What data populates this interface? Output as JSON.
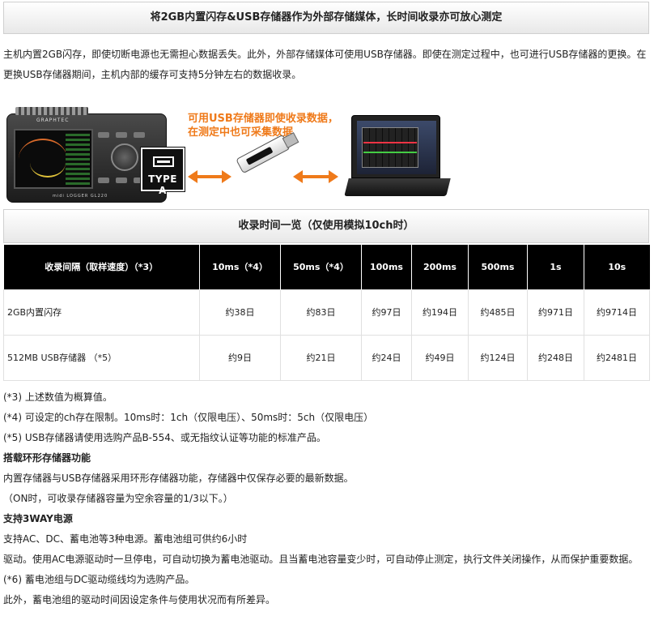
{
  "header": {
    "title": "将2GB内置闪存&USB存储器作为外部存储媒体，长时间收录亦可放心测定"
  },
  "intro": "主机内置2GB闪存，即使切断电源也无需担心数据丢失。此外，外部存储媒体可使用USB存储器。即使在测定过程中，也可进行USB存储器的更换。在更换USB存储器期间，主机内部的缓存可支持5分钟左右的数据收录。",
  "illustration": {
    "usb_caption_line1": "可用USB存储器即使收录数据，",
    "usb_caption_line2": "在测定中也可采集数据",
    "type_a_label": "TYPE A",
    "device_brand": "GRAPHTEC",
    "device_model": "midi LOGGER GL220",
    "accent_color": "#ef7a1a"
  },
  "table_section": {
    "title": "收录时间一览（仅使用模拟10ch时）",
    "columns": [
      "收录间隔（取样速度）（*3）",
      "10ms（*4）",
      "50ms（*4）",
      "100ms",
      "200ms",
      "500ms",
      "1s",
      "10s"
    ],
    "rows": [
      {
        "label": "2GB内置闪存",
        "cells": [
          "约38日",
          "约83日",
          "约97日",
          "约194日",
          "约485日",
          "约971日",
          "约9714日"
        ]
      },
      {
        "label": "512MB USB存储器 （*5）",
        "cells": [
          "约9日",
          "约21日",
          "约24日",
          "约49日",
          "约124日",
          "约248日",
          "约2481日"
        ]
      }
    ]
  },
  "notes": {
    "n3": "(*3) 上述数值为概算值。",
    "n4": "(*4) 可设定的ch存在限制。10ms时：1ch（仅限电压）、50ms时：5ch（仅限电压）",
    "n5": "(*5) USB存储器请使用选购产品B-554、或无指纹认证等功能的标准产品。",
    "ring_title": "搭载环形存储器功能",
    "ring_text1": "内置存储器与USB存储器采用环形存储器功能，存储器中仅保存必要的最新数据。",
    "ring_text2": "（ON时，可收录存储器容量为空余容量的1/3以下。）",
    "power_title": "支持3WAY电源",
    "power_text1": "支持AC、DC、蓄电池等3种电源。蓄电池组可供约6小时",
    "power_text2": "驱动。使用AC电源驱动时一旦停电，可自动切换为蓄电池驱动。且当蓄电池容量变少时，可自动停止测定，执行文件关闭操作，从而保护重要数据。",
    "n6": "(*6) 蓄电池组与DC驱动缆线均为选购产品。",
    "last": "此外，蓄电池组的驱动时间因设定条件与使用状况而有所差异。"
  }
}
